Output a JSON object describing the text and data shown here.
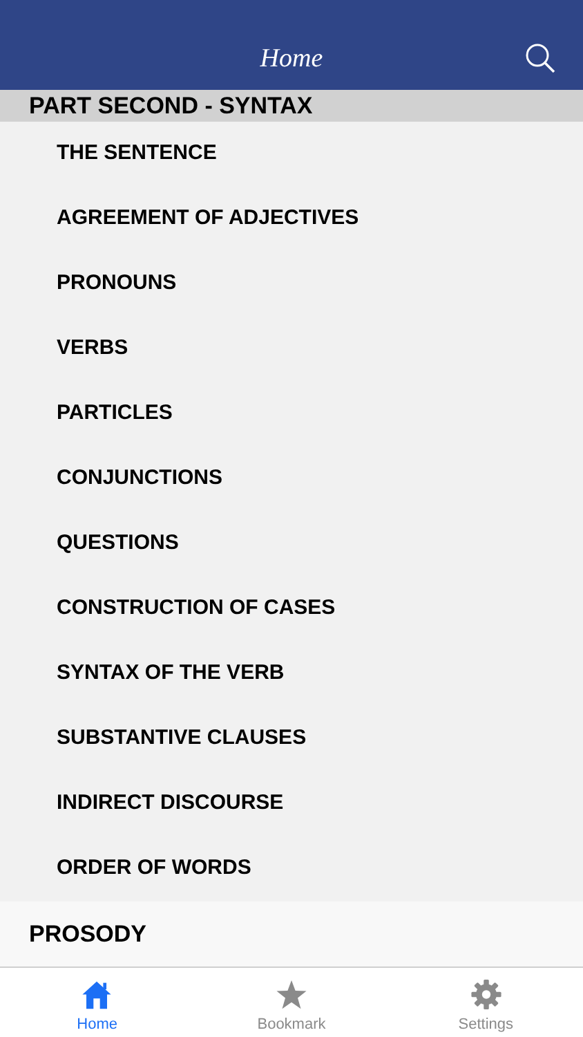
{
  "header": {
    "title": "Home"
  },
  "sections": [
    {
      "title": "PART SECOND - SYNTAX",
      "expanded": true,
      "items": [
        "THE SENTENCE",
        "AGREEMENT OF ADJECTIVES",
        "PRONOUNS",
        "VERBS",
        "PARTICLES",
        "CONJUNCTIONS",
        "QUESTIONS",
        "CONSTRUCTION OF CASES",
        "SYNTAX OF THE VERB",
        "SUBSTANTIVE CLAUSES",
        "INDIRECT DISCOURSE",
        "ORDER OF WORDS"
      ]
    },
    {
      "title": "PROSODY",
      "expanded": false
    }
  ],
  "tabs": [
    {
      "kind": "home",
      "label": "Home",
      "selected": true
    },
    {
      "kind": "bookmark",
      "label": "Bookmark",
      "selected": false
    },
    {
      "kind": "settings",
      "label": "Settings",
      "selected": false
    }
  ]
}
